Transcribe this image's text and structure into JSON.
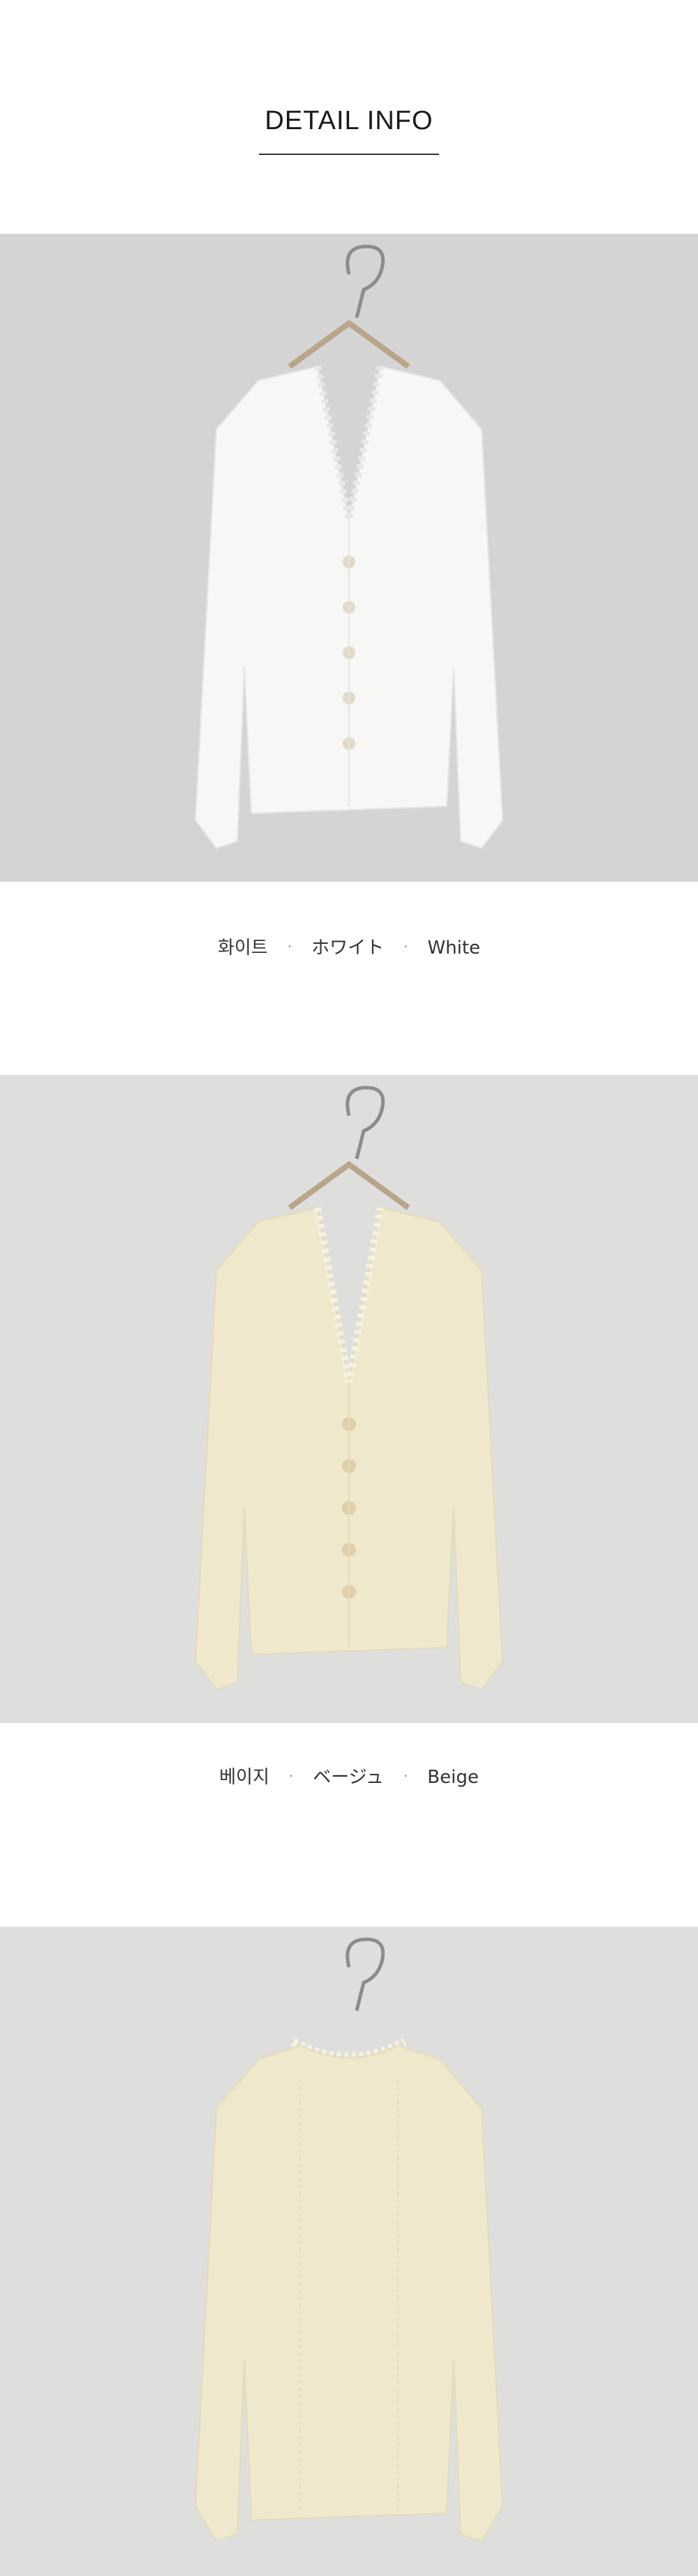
{
  "header": {
    "title": "DETAIL INFO"
  },
  "colors": {
    "background": "#ffffff",
    "photo_bg_white": "#d4d4d4",
    "photo_bg_beige": "#dededd",
    "garment_white": "#f7f7f5",
    "garment_beige": "#f0e8cc",
    "hanger": "#8c8c8c"
  },
  "items": [
    {
      "photo": {
        "alt": "White cardigan on hanger",
        "garment_color": "#f7f7f5",
        "icon": "blouse-front-icon"
      },
      "caption": {
        "korean": "화이트",
        "japanese": "ホワイト",
        "english": "White",
        "separator": "·"
      }
    },
    {
      "photo": {
        "alt": "Beige cardigan on hanger",
        "garment_color": "#f0e8cc",
        "icon": "blouse-front-icon"
      },
      "caption": {
        "korean": "베이지",
        "japanese": "ベージュ",
        "english": "Beige",
        "separator": "·"
      }
    },
    {
      "photo": {
        "alt": "Beige cardigan back view on hanger",
        "garment_color": "#f0e8cc",
        "icon": "blouse-back-icon"
      }
    }
  ]
}
